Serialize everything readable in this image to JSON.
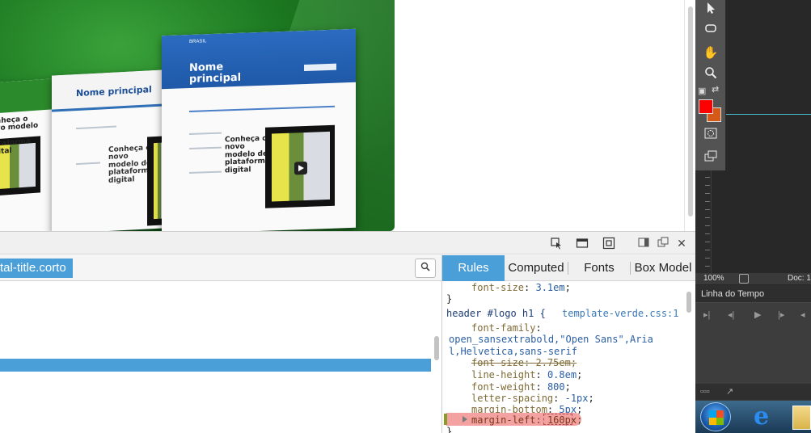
{
  "preview": {
    "site_label": "BRASIL",
    "headline_cards": [
      "Nome principal",
      "Nome principal"
    ],
    "story_title": "Conheça o novo modelo de plataforma digital"
  },
  "devtools": {
    "breadcrumb": "tal-title.corto",
    "tabs": [
      "Rules",
      "Computed",
      "Fonts",
      "Box Model"
    ],
    "active_tab": "Rules",
    "rules": {
      "prev_decl": {
        "prop": "font-size",
        "value": "3.1em"
      },
      "close_brace": "}",
      "selector": "header #logo h1 {",
      "source": "template-verde.css:1",
      "decls": [
        {
          "prop": "font-family",
          "value": "open_sansextrabold,\"Open Sans\",Arial,Helvetica,sans-serif",
          "struck": false
        },
        {
          "prop": "font-size",
          "value": "2.75em",
          "struck": true
        },
        {
          "prop": "line-height",
          "value": "0.8em",
          "struck": false
        },
        {
          "prop": "font-weight",
          "value": "800",
          "struck": false
        },
        {
          "prop": "letter-spacing",
          "value": "-1px",
          "struck": false
        },
        {
          "prop": "margin-bottom",
          "value": "5px",
          "struck": false
        },
        {
          "prop": "margin-left",
          "value": "160px",
          "struck": false,
          "highlighted": true
        }
      ],
      "trailing": "}"
    }
  },
  "photoshop": {
    "colors": {
      "foreground": "#ff0000",
      "background": "#d65a17"
    },
    "zoom": "100%",
    "doc_label": "Doc: 1",
    "timeline_title": "Linha do Tempo",
    "tools": [
      "move-tool",
      "rectangle-tool",
      "hand-tool",
      "zoom-tool",
      "quick-mask",
      "screen-mode"
    ]
  },
  "taskbar": {
    "items": [
      "start",
      "internet-explorer",
      "folder"
    ]
  }
}
